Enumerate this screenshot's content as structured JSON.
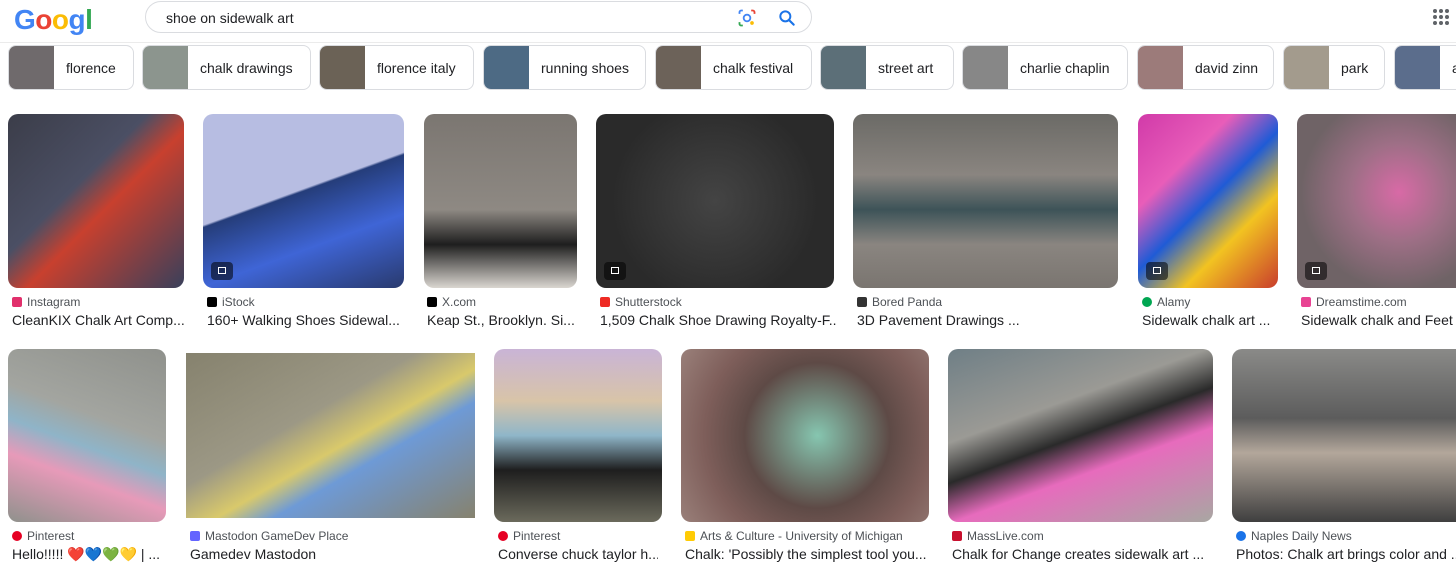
{
  "logo": {
    "letters": [
      "G",
      "o",
      "o",
      "g",
      "l",
      "e"
    ],
    "colors": [
      "#4285f4",
      "#ea4335",
      "#fbbc05",
      "#4285f4",
      "#34a853",
      "#ea4335"
    ]
  },
  "search": {
    "query": "shoe on sidewalk art"
  },
  "icons": {
    "lens": "google-lens-icon",
    "search": "search-icon",
    "apps": "apps-grid-icon"
  },
  "chips": [
    {
      "label": "florence",
      "thumb": "#6f6a6c"
    },
    {
      "label": "chalk drawings",
      "thumb": "#8c958e"
    },
    {
      "label": "florence italy",
      "thumb": "#6b6256"
    },
    {
      "label": "running shoes",
      "thumb": "#4d6a84"
    },
    {
      "label": "chalk festival",
      "thumb": "#6c6259"
    },
    {
      "label": "street art",
      "thumb": "#5c6f78"
    },
    {
      "label": "charlie chaplin",
      "thumb": "#878787"
    },
    {
      "label": "david zinn",
      "thumb": "#9c7b7a"
    },
    {
      "label": "park",
      "thumb": "#a39b8d"
    },
    {
      "label": "a",
      "thumb": "#5b6d8c"
    }
  ],
  "results_row1": [
    {
      "source": "Instagram",
      "title": "CleanKIX Chalk Art Comp...",
      "fav": "#e1306c",
      "img": [
        "#3b3d49",
        "#c8402e"
      ]
    },
    {
      "source": "iStock",
      "title": "160+ Walking Shoes Sidewal...",
      "fav": "#000000",
      "img": [
        "#b7bde2",
        "#253d7a"
      ]
    },
    {
      "source": "X.com",
      "title": "Keap St., Brooklyn. Si...",
      "fav": "#000000",
      "img": [
        "#7b7671",
        "#dad6d0"
      ]
    },
    {
      "source": "Shutterstock",
      "title": "1,509 Chalk Shoe Drawing Royalty-F...",
      "fav": "#ee2b24",
      "img": [
        "#2a2a2a",
        "#f1f1f1"
      ]
    },
    {
      "source": "Bored Panda",
      "title": "3D Pavement Drawings ...",
      "fav": "#333333",
      "img": [
        "#8a8580",
        "#3d5358"
      ]
    },
    {
      "source": "Alamy",
      "title": "Sidewalk chalk art ...",
      "fav": "#00a651",
      "img": [
        "#d13aa9",
        "#1f5bd6"
      ]
    },
    {
      "source": "Dreamstime.com",
      "title": "Sidewalk chalk and Feet s",
      "fav": "#e84393",
      "img": [
        "#6f6366",
        "#d86aa6"
      ]
    }
  ],
  "results_row2": [
    {
      "source": "Pinterest",
      "title": "Hello!!!!! ❤️💙💚💛 | ...",
      "fav": "#e60023",
      "img": [
        "#8f918c",
        "#8fb4c8"
      ]
    },
    {
      "source": "Mastodon GameDev Place",
      "title": "Gamedev Mastodon",
      "fav": "#6364ff",
      "img": [
        "#86826e",
        "#d9c96b"
      ]
    },
    {
      "source": "Pinterest",
      "title": "Converse chuck taylor h...",
      "fav": "#e60023",
      "img": [
        "#6b6a5c",
        "#c9b4d6"
      ]
    },
    {
      "source": "Arts & Culture - University of Michigan",
      "title": "Chalk: 'Possibly the simplest tool you...",
      "fav": "#ffcb05",
      "img": [
        "#7e5e5a",
        "#86c6b0"
      ]
    },
    {
      "source": "MassLive.com",
      "title": "Chalk for Change creates sidewalk art ...",
      "fav": "#c8102e",
      "img": [
        "#9b9a95",
        "#e76bbd"
      ]
    },
    {
      "source": "Naples Daily News",
      "title": "Photos: Chalk art brings color and ...",
      "fav": "#1a73e8",
      "img": [
        "#5c5c5c",
        "#b3a79b"
      ]
    }
  ]
}
